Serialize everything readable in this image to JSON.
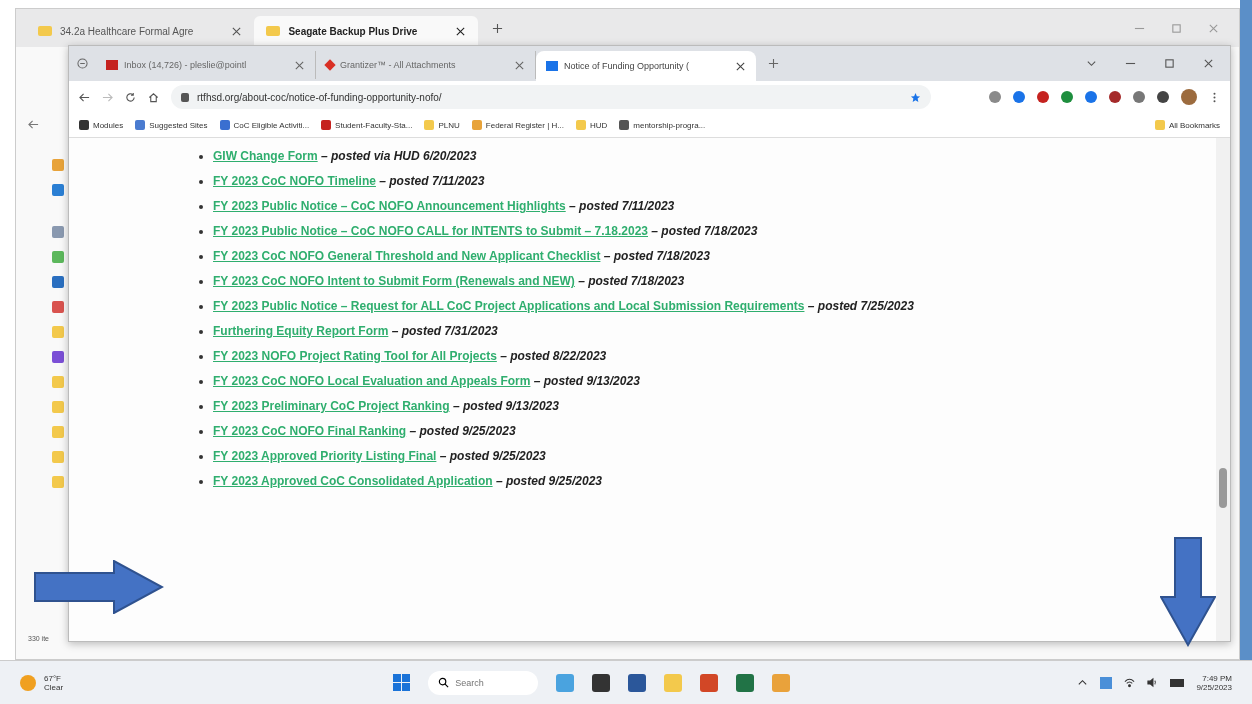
{
  "explorer": {
    "tabs": [
      {
        "title": "34.2a Healthcare Formal Agre",
        "selected": false
      },
      {
        "title": "Seagate Backup Plus Drive",
        "selected": true
      }
    ],
    "status": "330 ite"
  },
  "browser": {
    "tabs": [
      {
        "title": "Inbox (14,726) - pleslie@pointl",
        "selected": false
      },
      {
        "title": "Grantizer™ - All Attachments",
        "selected": false
      },
      {
        "title": "Notice of Funding Opportunity (",
        "selected": true
      }
    ],
    "url": "rtfhsd.org/about-coc/notice-of-funding-opportunity-nofo/",
    "bookmarks": [
      "Modules",
      "Suggested Sites",
      "CoC Eligible Activiti...",
      "Student-Faculty-Sta...",
      "PLNU",
      "Federal Register | H...",
      "HUD",
      "mentorship-progra..."
    ],
    "all_bookmarks": "All Bookmarks",
    "items": [
      {
        "link": "GIW Change Form",
        "note": "– posted via HUD 6/20/2023"
      },
      {
        "link": "FY 2023 CoC NOFO Timeline",
        "note": "– posted 7/11/2023"
      },
      {
        "link": "FY 2023 Public Notice – CoC NOFO Announcement Highlights",
        "note": "– posted 7/11/2023"
      },
      {
        "link": "FY 2023 Public Notice – CoC NOFO CALL for INTENTS to Submit – 7.18.2023",
        "note": "– posted 7/18/2023"
      },
      {
        "link": "FY 2023 CoC NOFO General Threshold and New Applicant Checklist",
        "note": "– posted 7/18/2023"
      },
      {
        "link": "FY 2023 CoC NOFO Intent to Submit Form (Renewals and NEW)",
        "note": "– posted 7/18/2023"
      },
      {
        "link": "FY 2023 Public Notice – Request for ALL CoC Project Applications and Local Submission Requirements",
        "note": "– posted 7/25/2023"
      },
      {
        "link": "Furthering Equity Report Form",
        "note": "– posted 7/31/2023"
      },
      {
        "link": "FY 2023 NOFO Project Rating Tool for All Projects",
        "note": "– posted 8/22/2023"
      },
      {
        "link": "FY 2023 CoC NOFO Local Evaluation and Appeals Form",
        "note": "– posted 9/13/2023"
      },
      {
        "link": "FY 2023 Preliminary CoC Project Ranking",
        "note": "– posted 9/13/2023"
      },
      {
        "link": "FY 2023 CoC NOFO Final Ranking",
        "note": "– posted 9/25/2023"
      },
      {
        "link": "FY 2023 Approved Priority Listing Final",
        "note": "– posted 9/25/2023"
      },
      {
        "link": "FY 2023 Approved CoC Consolidated Application",
        "note": "– posted 9/25/2023"
      }
    ]
  },
  "taskbar": {
    "temperature": "67°F",
    "condition": "Clear",
    "search_placeholder": "Search",
    "time": "7:49 PM",
    "date": "9/25/2023"
  }
}
